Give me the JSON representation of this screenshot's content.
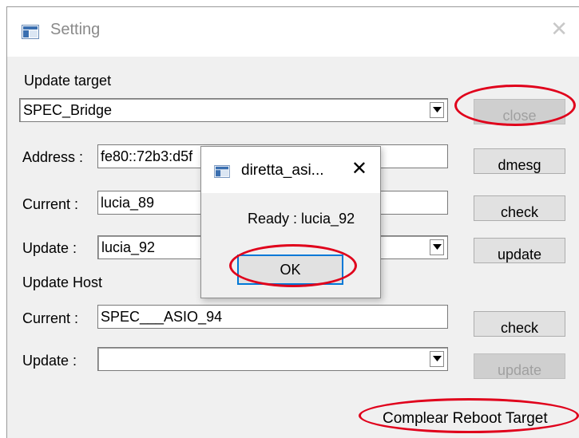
{
  "window": {
    "title": "Setting"
  },
  "update_target": {
    "section_label": "Update target",
    "target_select": "SPEC_Bridge",
    "close_label": "close",
    "address_label": "Address :",
    "address_value": "fe80::72b3:d5f",
    "dmesg_label": "dmesg",
    "current_label": "Current :",
    "current_value": "lucia_89",
    "check_label": "check",
    "update_label": "Update :",
    "update_value": "lucia_92",
    "update_button": "update"
  },
  "update_host": {
    "section_label": "Update Host",
    "current_label": "Current :",
    "current_value": "SPEC___ASIO_94",
    "check_label": "check",
    "update_label": "Update :",
    "update_value": "",
    "update_button": "update"
  },
  "reboot_label": "Complear Reboot Target",
  "dialog": {
    "title": "diretta_asi...",
    "message": "Ready : lucia_92",
    "ok_label": "OK"
  },
  "colors": {
    "annotation": "#e0001b",
    "focus": "#0078d7"
  }
}
